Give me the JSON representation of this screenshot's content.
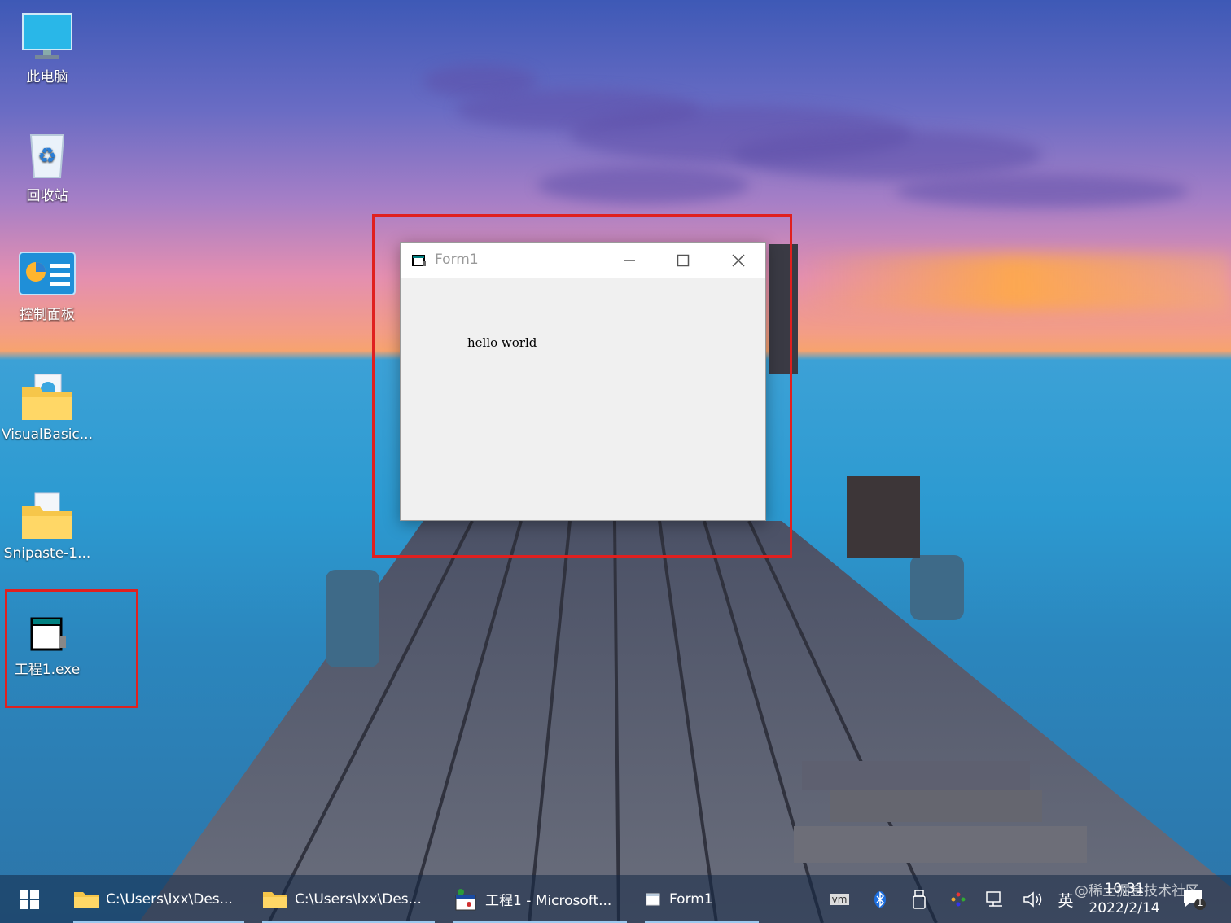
{
  "desktop_icons": [
    {
      "label": "此电脑",
      "icon": "computer-icon"
    },
    {
      "label": "回收站",
      "icon": "recycle-bin-icon"
    },
    {
      "label": "控制面板",
      "icon": "control-panel-icon"
    },
    {
      "label": "VisualBasic...",
      "icon": "folder-icon"
    },
    {
      "label": "Snipaste-1...",
      "icon": "folder-icon"
    },
    {
      "label": "工程1.exe",
      "icon": "vb-app-icon"
    }
  ],
  "window": {
    "title": "Form1",
    "content_text": "hello world"
  },
  "taskbar": {
    "items": [
      {
        "label": "C:\\Users\\lxx\\Des...",
        "icon": "folder-icon"
      },
      {
        "label": "C:\\Users\\lxx\\Des...",
        "icon": "folder-icon"
      },
      {
        "label": "工程1 - Microsoft...",
        "icon": "vb6-icon"
      },
      {
        "label": "Form1",
        "icon": "form-window-icon"
      }
    ],
    "tray": {
      "vm_label": "vm",
      "ime": "英",
      "time": "10:31",
      "date": "2022/2/14",
      "notification_count": "1"
    },
    "watermark": "@稀土掘金技术社区"
  },
  "colors": {
    "highlight_box": "#e0201f",
    "taskbar_accent": "#9cc9ef"
  }
}
